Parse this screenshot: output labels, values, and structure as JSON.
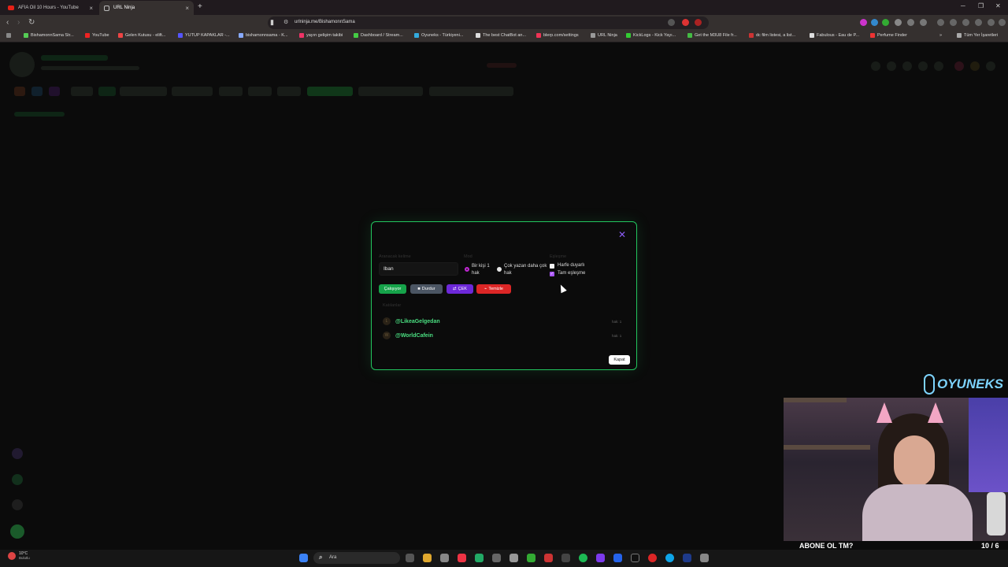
{
  "browser": {
    "tabs": [
      {
        "title": "AFIA Oil 10 Hours - YouTube"
      },
      {
        "title": "URL Ninja"
      }
    ],
    "url": "urlninja.me/BishamonnSama",
    "bookmarks": [
      "BishamonnSama Str...",
      "YouTube",
      "Gelen Kutusu - elift...",
      "YUTUP KAPAKLAR -...",
      "bishamonnsama - K...",
      "yayın gelişim takibi",
      "Dashboard / Stream...",
      "Oyuneks - Türkiyeni...",
      "The best ChatBot an...",
      "blerp.com/settings",
      "URL Ninja",
      "KickLogs - Kick Yayı...",
      "Get the M3U8 File fr...",
      "dc film listesi, a list...",
      "Fabulous - Eau de P...",
      "Perfume Finder"
    ],
    "all_bookmarks": "Tüm Yer İşaretleri"
  },
  "modal": {
    "keyword_label": "Aranacak kelime",
    "keyword_value": "Iban",
    "mode_label": "Mod",
    "mode_option_1": "Bir kişi 1 hak",
    "mode_option_2": "Çok yazan daha çok hak",
    "match_label": "Eşleşme",
    "match_option_1": "Harfe duyarlı",
    "match_option_2": "Tam eşleşme",
    "buttons": {
      "running": "Çalışıyor",
      "stop": "Durdur",
      "draw": "ÇEK",
      "clear": "Temizle"
    },
    "participants_label": "Katılanlar",
    "participants": [
      {
        "initial": "L",
        "name": "@LikeaGelgedan",
        "hak": "hak: 1"
      },
      {
        "initial": "W",
        "name": "@WorldCafein",
        "hak": "hak: 1"
      }
    ],
    "close_label": "Kapat",
    "close_icon": "close-icon"
  },
  "overlay": {
    "brand": "OYUNEKS",
    "sub_label": "ABONE OL TM?",
    "sub_count": "10 / 6",
    "sub_progress": 1.0
  },
  "taskbar": {
    "temp": "10°C",
    "condition": "Bulutlu",
    "search_placeholder": "Ara"
  }
}
